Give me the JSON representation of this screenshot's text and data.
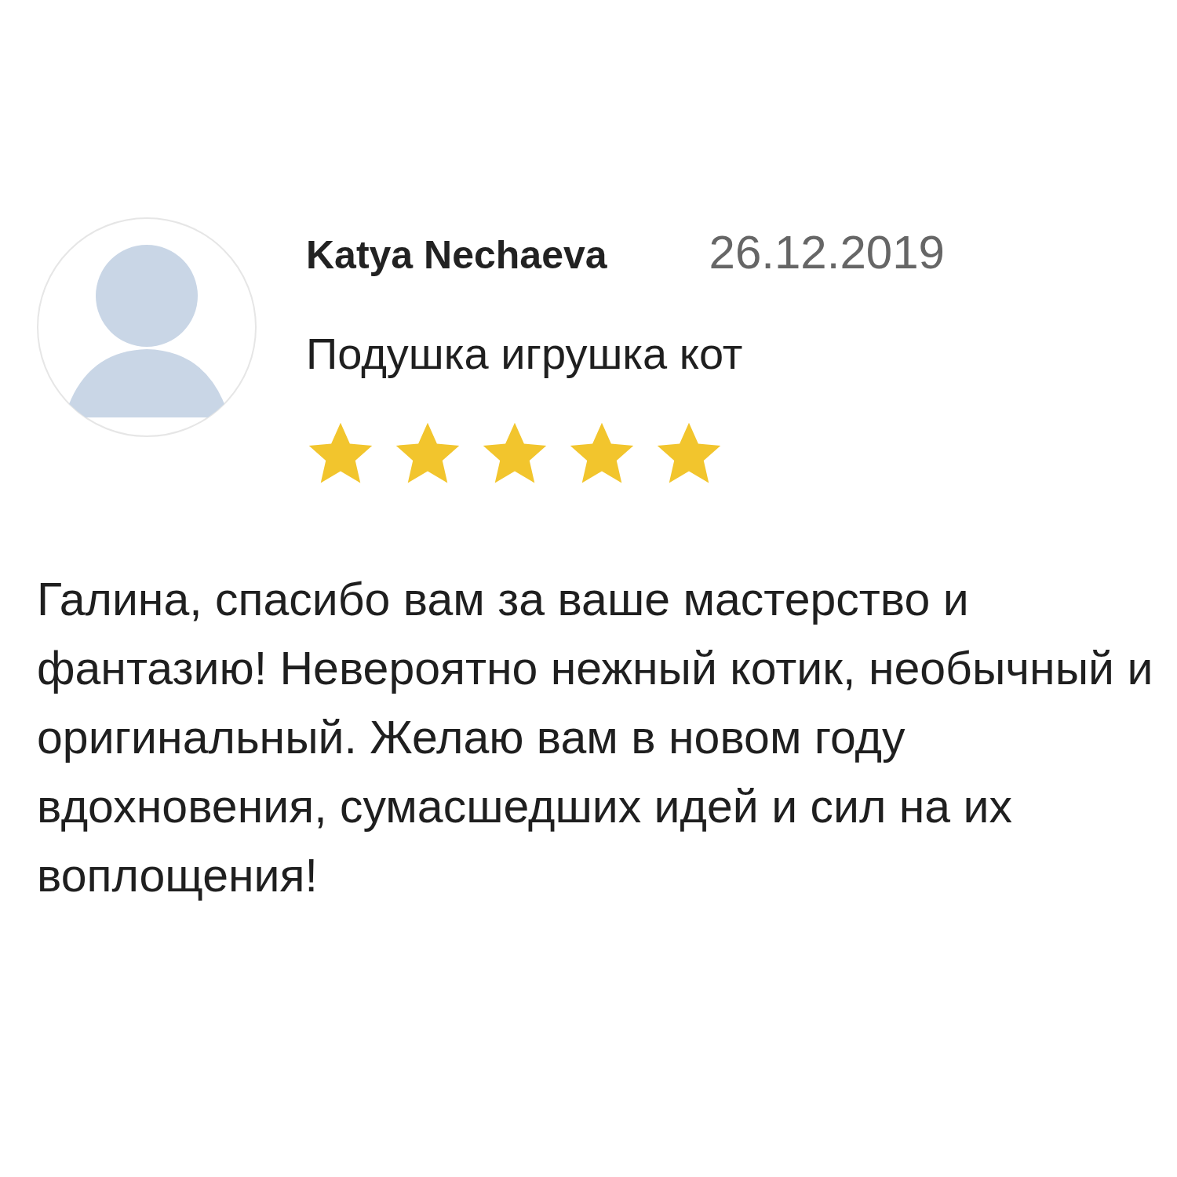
{
  "review": {
    "author": "Katya Nechaeva",
    "date": "26.12.2019",
    "product": "Подушка игрушка кот",
    "stars": 5,
    "text": "Галина, спасибо вам за ваше мастерство и фантазию! Невероятно нежный котик, необычный и оригинальный. Желаю вам в новом году вдохновения, сумасшедших идей и сил на их воплощения!"
  }
}
